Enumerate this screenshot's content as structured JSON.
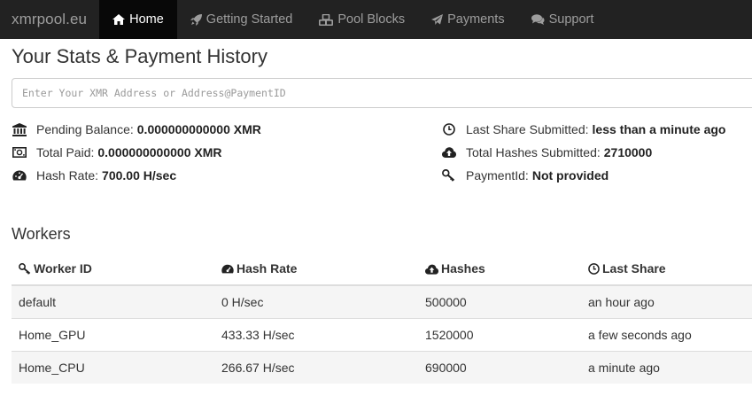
{
  "navbar": {
    "brand": "xmrpool.eu",
    "items": [
      {
        "label": "Home",
        "icon": "home-icon",
        "active": true
      },
      {
        "label": "Getting Started",
        "icon": "rocket-icon",
        "active": false
      },
      {
        "label": "Pool Blocks",
        "icon": "cubes-icon",
        "active": false
      },
      {
        "label": "Payments",
        "icon": "paper-plane-icon",
        "active": false
      },
      {
        "label": "Support",
        "icon": "comments-icon",
        "active": false
      }
    ]
  },
  "page": {
    "title": "Your Stats & Payment History",
    "address_placeholder": "Enter Your XMR Address or Address@PaymentID"
  },
  "stats": {
    "pending_balance": {
      "label": "Pending Balance:",
      "value": "0.000000000000 XMR",
      "icon": "bank-icon"
    },
    "total_paid": {
      "label": "Total Paid:",
      "value": "0.000000000000 XMR",
      "icon": "money-icon"
    },
    "hash_rate": {
      "label": "Hash Rate:",
      "value": "700.00 H/sec",
      "icon": "dashboard-icon"
    },
    "last_share": {
      "label": "Last Share Submitted:",
      "value": "less than a minute ago",
      "icon": "clock-icon"
    },
    "total_hashes": {
      "label": "Total Hashes Submitted:",
      "value": "2710000",
      "icon": "cloud-upload-icon"
    },
    "payment_id": {
      "label": "PaymentId:",
      "value": "Not provided",
      "icon": "key-icon"
    }
  },
  "workers": {
    "title": "Workers",
    "columns": [
      {
        "label": "Worker ID",
        "icon": "key-icon"
      },
      {
        "label": "Hash Rate",
        "icon": "dashboard-icon"
      },
      {
        "label": "Hashes",
        "icon": "cloud-upload-icon"
      },
      {
        "label": "Last Share",
        "icon": "clock-icon"
      }
    ],
    "rows": [
      [
        "default",
        "0 H/sec",
        "500000",
        "an hour ago"
      ],
      [
        "Home_GPU",
        "433.33 H/sec",
        "1520000",
        "a few seconds ago"
      ],
      [
        "Home_CPU",
        "266.67 H/sec",
        "690000",
        "a minute ago"
      ]
    ]
  }
}
